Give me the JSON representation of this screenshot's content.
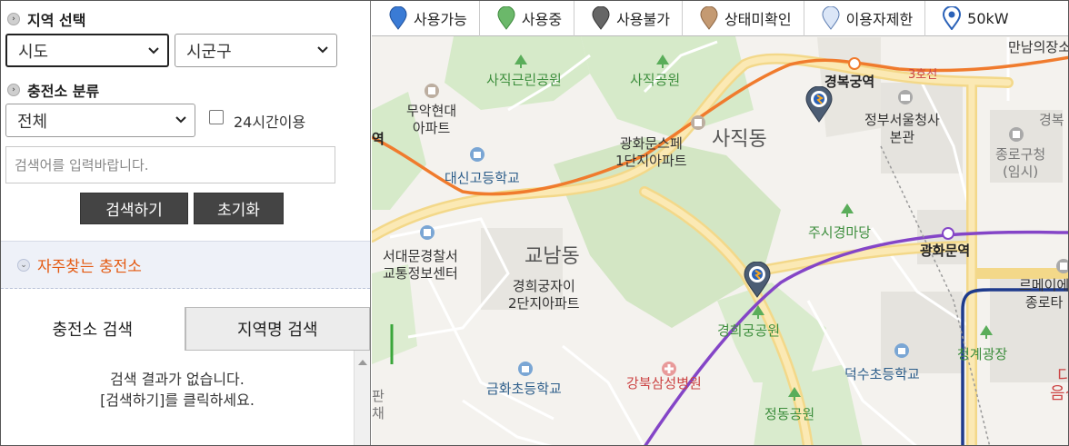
{
  "left": {
    "region_title": "지역 선택",
    "sido": "시도",
    "sigungu": "시군구",
    "category_title": "충전소 분류",
    "category": "전체",
    "24h_label": "24시간이용",
    "search_placeholder": "검색어를 입력바랍니다.",
    "search_btn": "검색하기",
    "reset_btn": "초기화",
    "favorites": "자주찾는 충전소",
    "tab_station": "충전소 검색",
    "tab_region": "지역명 검색",
    "result_line1": "검색 결과가 없습니다.",
    "result_line2": "[검색하기]를 클릭하세요."
  },
  "legend": [
    {
      "label": "사용가능",
      "color": "#3a7bd5"
    },
    {
      "label": "사용중",
      "color": "#6bb86a"
    },
    {
      "label": "사용불가",
      "color": "#666666"
    },
    {
      "label": "상태미확인",
      "color": "#c49a72"
    },
    {
      "label": "이용자제한",
      "color": "#c9d8f2"
    },
    {
      "label": "50kW",
      "color": "#3a7bd5"
    }
  ],
  "map": {
    "labels": {
      "sajik_park_near": "사직근린공원",
      "sajik_park": "사직공원",
      "gyeongbokgung": "경복궁역",
      "line3": "3호선",
      "manam": "만남의장소",
      "muak1": "무악현대",
      "muak2": "아파트",
      "yeok": "역",
      "gwanghwamun_apt1": "광화문스페",
      "gwanghwamun_apt2": "1단지아파트",
      "sajikdong": "사직동",
      "gov1": "정부서울청사",
      "gov2": "본관",
      "daesin": "대신고등학교",
      "jongno1": "종로구청",
      "jongno2": "(임시)",
      "gyeongbu": "경복",
      "jusi": "주시경마당",
      "gwanghwamun_stn": "광화문역",
      "seodaemun1": "서대문경찰서",
      "seodaemun2": "교통정보센터",
      "gyonamdong": "교남동",
      "gyeonghui1": "경희궁자이",
      "gyeonghui2": "2단지아파트",
      "lemeilleur1": "르메이에",
      "lemeilleur2": "종로타",
      "gyeonghui_park": "경희궁공원",
      "cheonggye": "청계광장",
      "geumhwa": "금화초등학교",
      "gangbuk": "강북삼성병원",
      "deoksu": "덕수초등학교",
      "jeongdong": "정동공원",
      "da": "다",
      "eumsik": "음식",
      "panche1": "판",
      "panche2": "채"
    }
  }
}
